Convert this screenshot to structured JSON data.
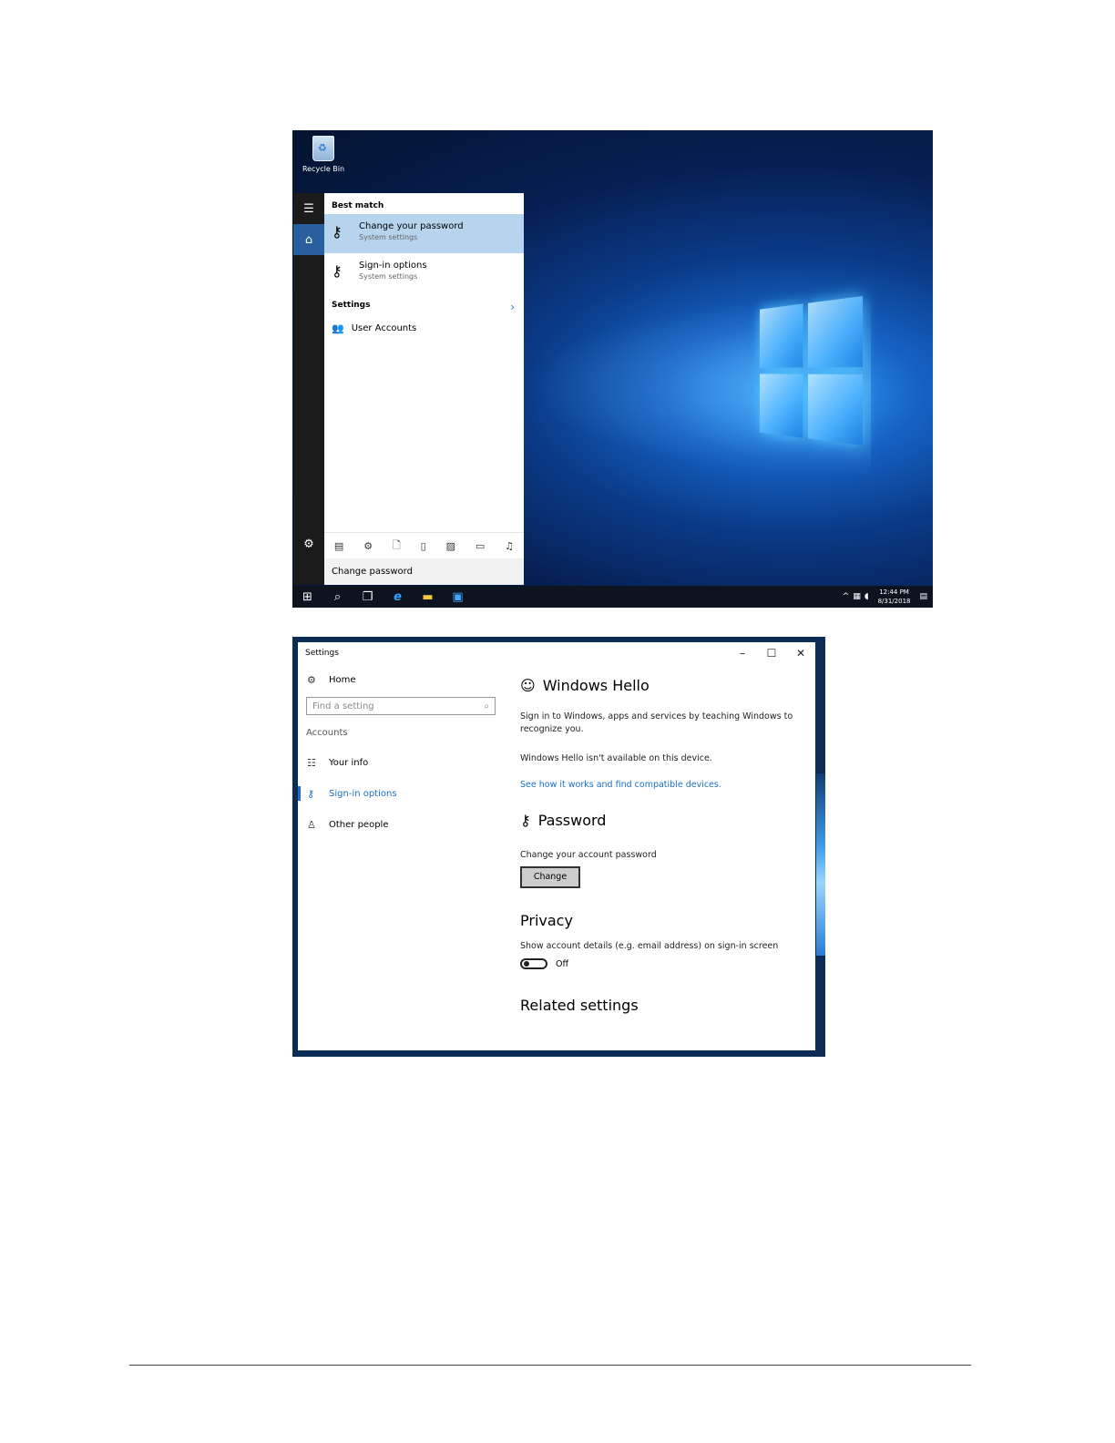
{
  "desktop": {
    "recycle_bin_label": "Recycle Bin",
    "search": {
      "best_match_header": "Best match",
      "results": [
        {
          "title": "Change your password",
          "subtitle": "System settings"
        },
        {
          "title": "Sign-in options",
          "subtitle": "System settings"
        }
      ],
      "settings_header": "Settings",
      "settings_items": [
        {
          "label": "User Accounts"
        }
      ],
      "query": "Change password"
    },
    "taskbar": {
      "time": "12:44 PM",
      "date": "8/31/2018"
    }
  },
  "settings_window": {
    "title": "Settings",
    "sidebar": {
      "home_label": "Home",
      "search_placeholder": "Find a setting",
      "section_label": "Accounts",
      "items": [
        {
          "label": "Your info"
        },
        {
          "label": "Sign-in options"
        },
        {
          "label": "Other people"
        }
      ],
      "active_item": "Sign-in options"
    },
    "main": {
      "hello_heading": "Windows Hello",
      "hello_desc": "Sign in to Windows, apps and services by teaching Windows to recognize you.",
      "hello_unavailable": "Windows Hello isn't available on this device.",
      "hello_link": "See how it works and find compatible devices.",
      "password_heading": "Password",
      "password_desc": "Change your account password",
      "change_button": "Change",
      "privacy_heading": "Privacy",
      "privacy_desc": "Show account details (e.g. email address) on sign-in screen",
      "privacy_toggle_state": "Off",
      "related_heading": "Related settings"
    }
  },
  "colors": {
    "accent": "#1a6fc4",
    "selected_result": "#b6d4ee",
    "taskbar": "#0d1420"
  }
}
